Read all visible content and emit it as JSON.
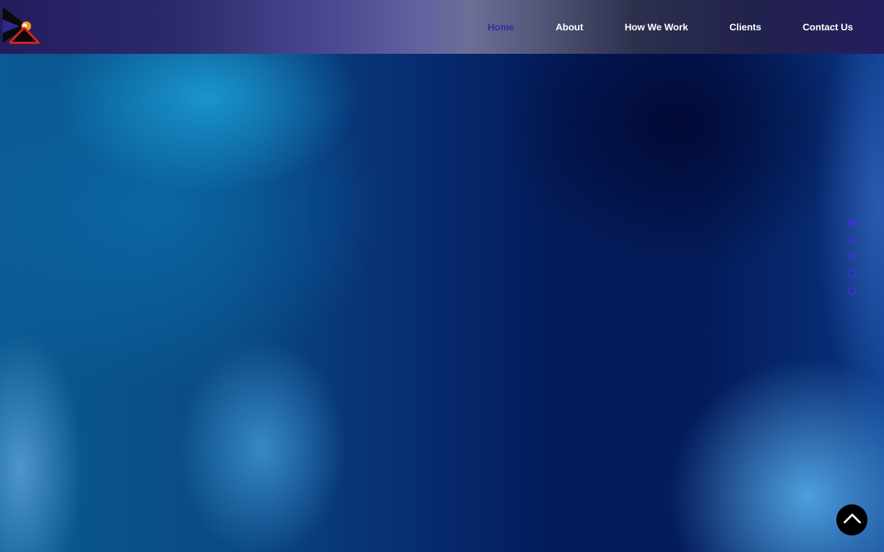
{
  "header": {
    "logo_icon": "brand-triangle-logo-icon",
    "nav": [
      {
        "label": "Home",
        "active": true
      },
      {
        "label": "About",
        "active": false
      },
      {
        "label": "How We Work",
        "active": false
      },
      {
        "label": "Clients",
        "active": false
      },
      {
        "label": "Contact Us",
        "active": false
      }
    ]
  },
  "side_nav": {
    "dots": [
      {
        "section": 1,
        "active": true
      },
      {
        "section": 2,
        "active": false
      },
      {
        "section": 3,
        "active": false
      },
      {
        "section": 4,
        "active": false
      },
      {
        "section": 5,
        "active": false
      }
    ],
    "color": "#3b36c8"
  },
  "back_to_top": {
    "icon": "chevron-up-icon",
    "color": "#000000"
  },
  "colors": {
    "header_start": "#231d5e",
    "nav_text": "#ffffff",
    "nav_active": "#2c2fa6",
    "hero_dark": "#041c5c",
    "hero_light": "#1ca0d7"
  }
}
